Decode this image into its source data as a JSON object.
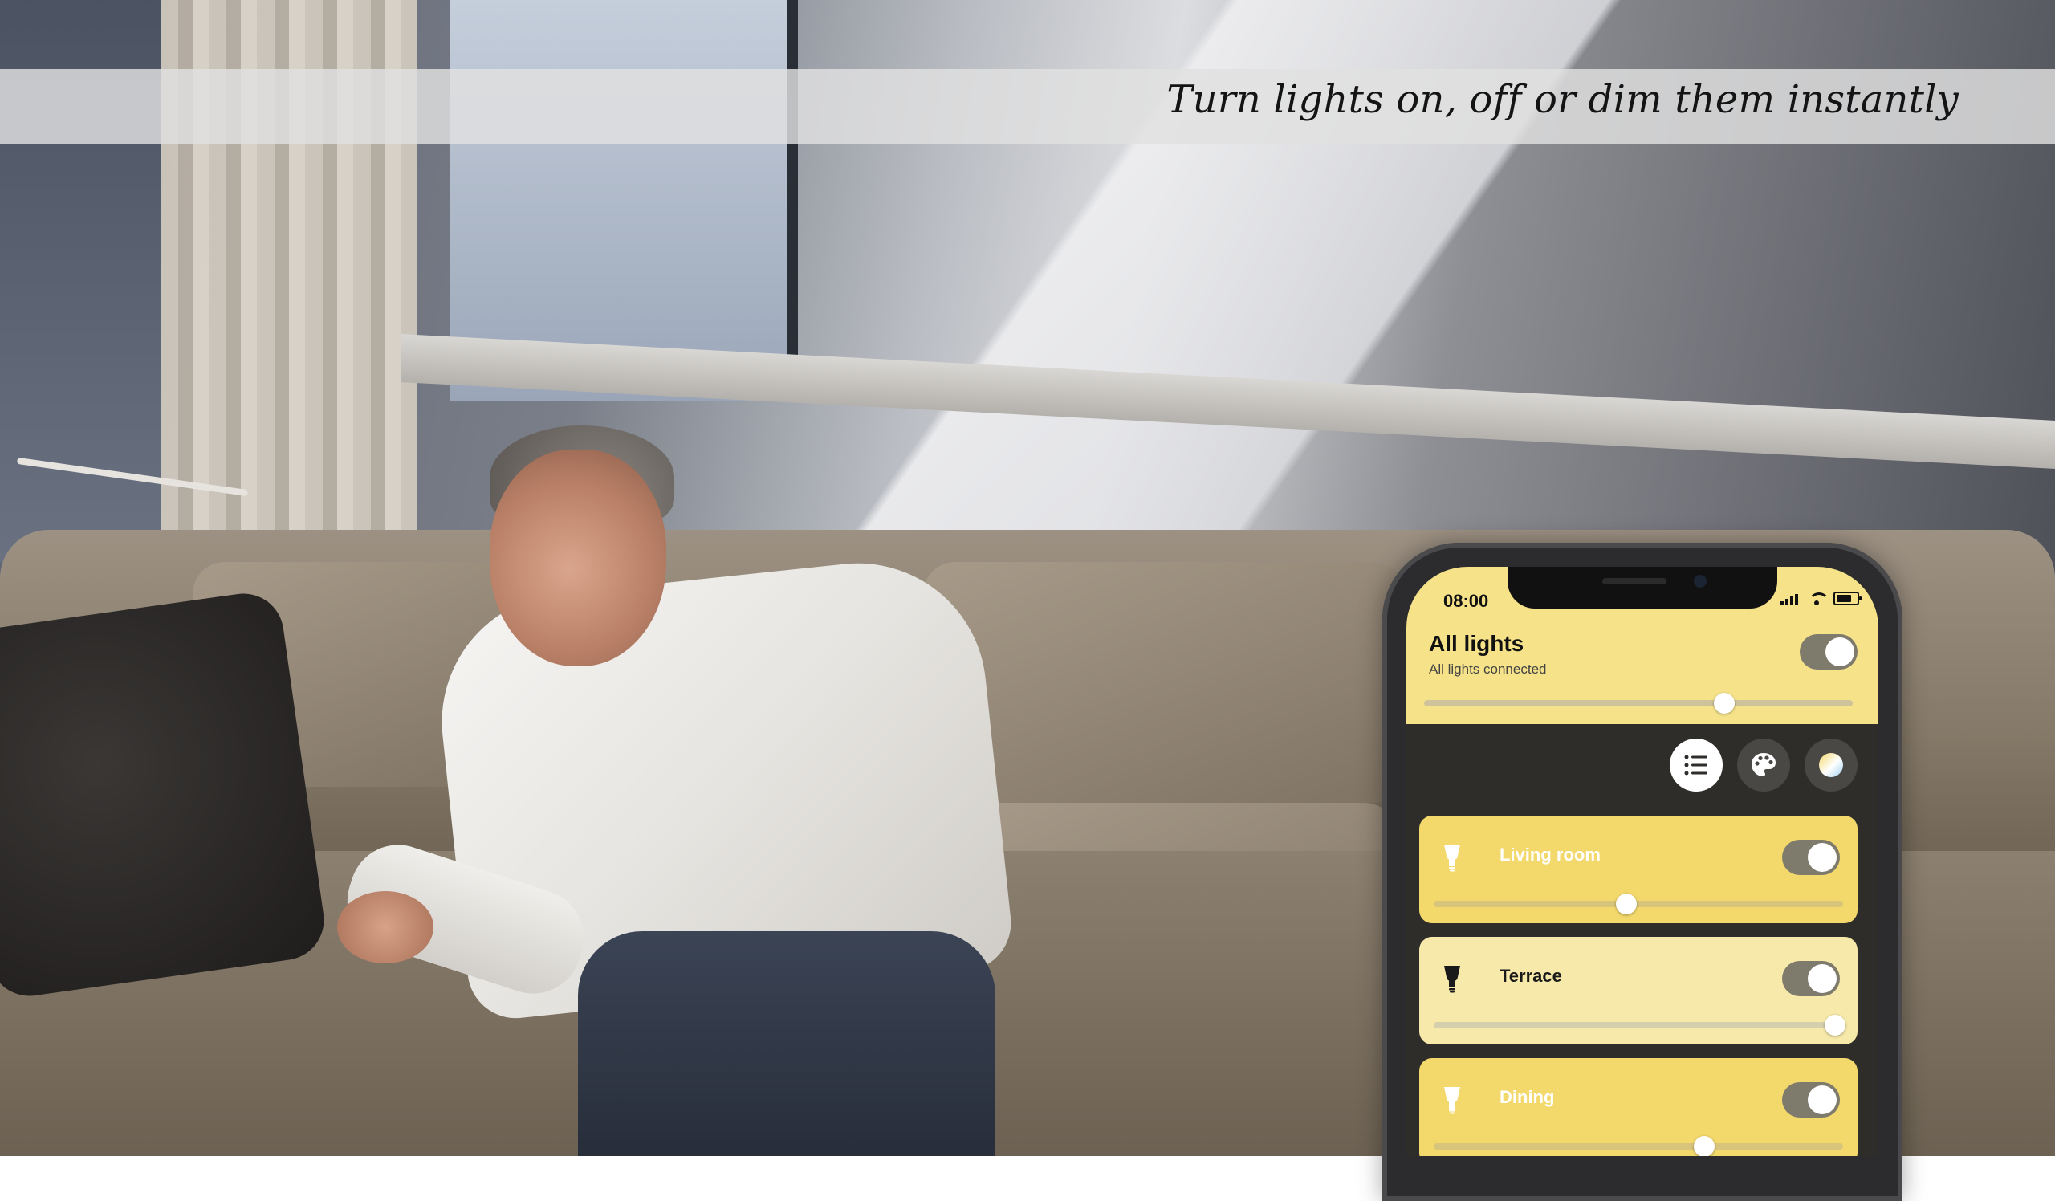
{
  "headline": "Turn lights on, off or dim them instantly",
  "phone": {
    "status_time": "08:00",
    "all_lights": {
      "title": "All lights",
      "subtitle": "All lights connected",
      "on": true,
      "brightness": 0.7
    },
    "view_buttons": [
      "list-view-icon",
      "palette-icon",
      "color-scene-icon"
    ],
    "rooms": [
      {
        "name": "Living room",
        "on": true,
        "brightness": 0.47,
        "color": "#f3d86b",
        "text_color": "#ffffff",
        "bulb_color": "#ffffff"
      },
      {
        "name": "Terrace",
        "on": true,
        "brightness": 0.98,
        "color": "#f7e9a9",
        "text_color": "#1a1a1a",
        "bulb_color": "#1a1a1a"
      },
      {
        "name": "Dining",
        "on": true,
        "brightness": 0.66,
        "color": "#f3d86b",
        "text_color": "#ffffff",
        "bulb_color": "#ffffff"
      }
    ]
  },
  "colors": {
    "hero": "#f6e389",
    "screen_bg": "#2f2d2a"
  }
}
